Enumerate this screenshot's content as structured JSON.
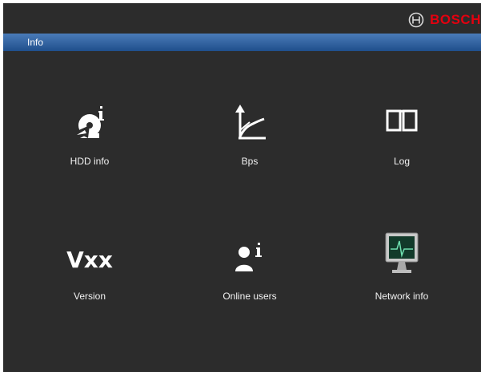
{
  "brand": {
    "name": "BOSCH",
    "color": "#e3000f"
  },
  "window": {
    "title": "Info"
  },
  "tiles": [
    {
      "label": "HDD info",
      "icon": "hdd-info-icon"
    },
    {
      "label": "Bps",
      "icon": "bps-graph-icon"
    },
    {
      "label": "Log",
      "icon": "log-book-icon"
    },
    {
      "label": "Version",
      "icon": "version-icon",
      "icon_text": "Vxx"
    },
    {
      "label": "Online users",
      "icon": "online-users-icon"
    },
    {
      "label": "Network info",
      "icon": "network-monitor-icon"
    }
  ],
  "colors": {
    "background": "#2c2c2c",
    "titlebar": "#2b5c9c",
    "text": "#f2f2f2"
  }
}
